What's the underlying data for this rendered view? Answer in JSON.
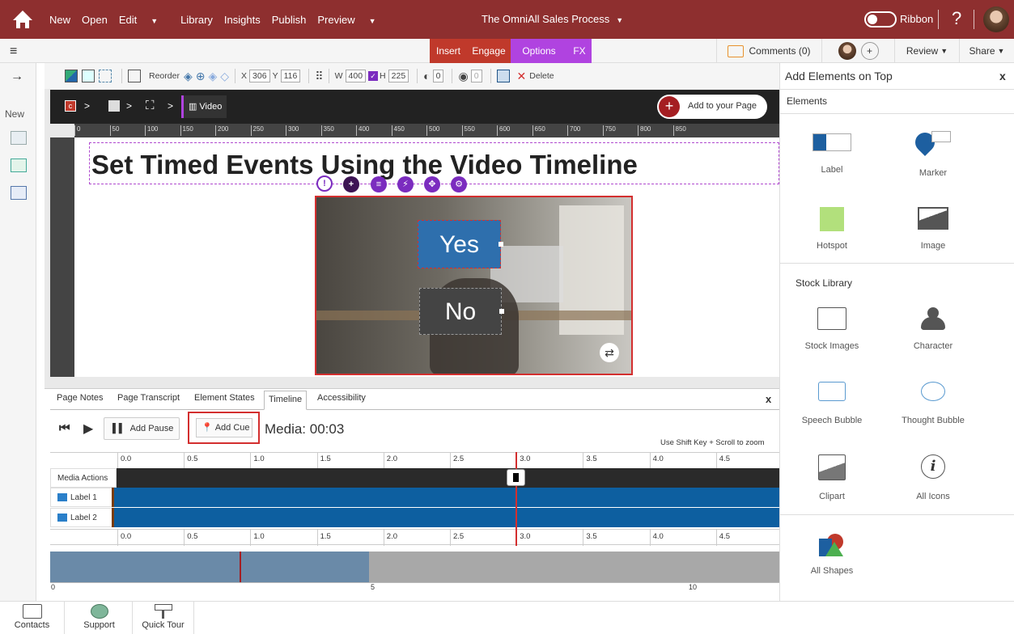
{
  "topbar": {
    "nav": [
      "New",
      "Open",
      "Edit",
      "Library",
      "Insights",
      "Publish",
      "Preview"
    ],
    "title": "The OmniAll Sales Process",
    "ribbon_label": "Ribbon",
    "help": "?"
  },
  "bar2": {
    "tabs": [
      "Insert",
      "Engage",
      "Options",
      "FX"
    ],
    "comments": "Comments (0)",
    "plus": "+",
    "review": "Review",
    "share": "Share"
  },
  "rail": {
    "new_label": "New"
  },
  "toolbar": {
    "reorder": "Reorder",
    "x_label": "X",
    "x_value": "306",
    "y_label": "Y",
    "y_value": "116",
    "w_label": "W",
    "w_value": "400",
    "h_label": "H",
    "h_value": "225",
    "opacity": "0",
    "rotate": "0",
    "delete": "Delete"
  },
  "breadcrumb": {
    "current": "Video",
    "add_button": "Add to your Page"
  },
  "ruler": [
    "0",
    "50",
    "100",
    "150",
    "200",
    "250",
    "300",
    "350",
    "400",
    "450",
    "500",
    "550",
    "600",
    "650",
    "700",
    "750",
    "800",
    "850"
  ],
  "canvas": {
    "title": "Set Timed Events Using the Video Timeline",
    "yes": "Yes",
    "no": "No"
  },
  "panel": {
    "tabs": [
      "Page Notes",
      "Page Transcript",
      "Element States",
      "Timeline",
      "Accessibility"
    ],
    "close": "x",
    "add_pause": "Add Pause",
    "add_cue": "Add Cue",
    "media_time": "Media: 00:03",
    "zoom_hint": "Use Shift Key + Scroll to zoom",
    "ticks": [
      "0.0",
      "0.5",
      "1.0",
      "1.5",
      "2.0",
      "2.5",
      "3.0",
      "3.5",
      "4.0",
      "4.5"
    ],
    "rows": [
      "Media Actions",
      "Label 1",
      "Label 2"
    ],
    "overview_ticks": [
      "0",
      "5",
      "10"
    ],
    "playhead_seconds": 2.95
  },
  "right_panel": {
    "title": "Add Elements on Top",
    "close": "x",
    "elements_heading": "Elements",
    "elements": [
      "Label",
      "Marker",
      "Hotspot",
      "Image"
    ],
    "stock_heading": "Stock Library",
    "stock": [
      "Stock Images",
      "Character",
      "Speech Bubble",
      "Thought Bubble",
      "Clipart",
      "All Icons",
      "All Shapes"
    ]
  },
  "bottom": [
    "Contacts",
    "Support",
    "Quick Tour"
  ],
  "colors": {
    "brand": "#8e2f2f",
    "insert_tab": "#c0392b",
    "options_tab": "#b043e0",
    "timeline_bar": "#0d5fa0",
    "yes_button": "#2e6fad",
    "no_button": "#444444",
    "playhead": "#d32f2f"
  }
}
